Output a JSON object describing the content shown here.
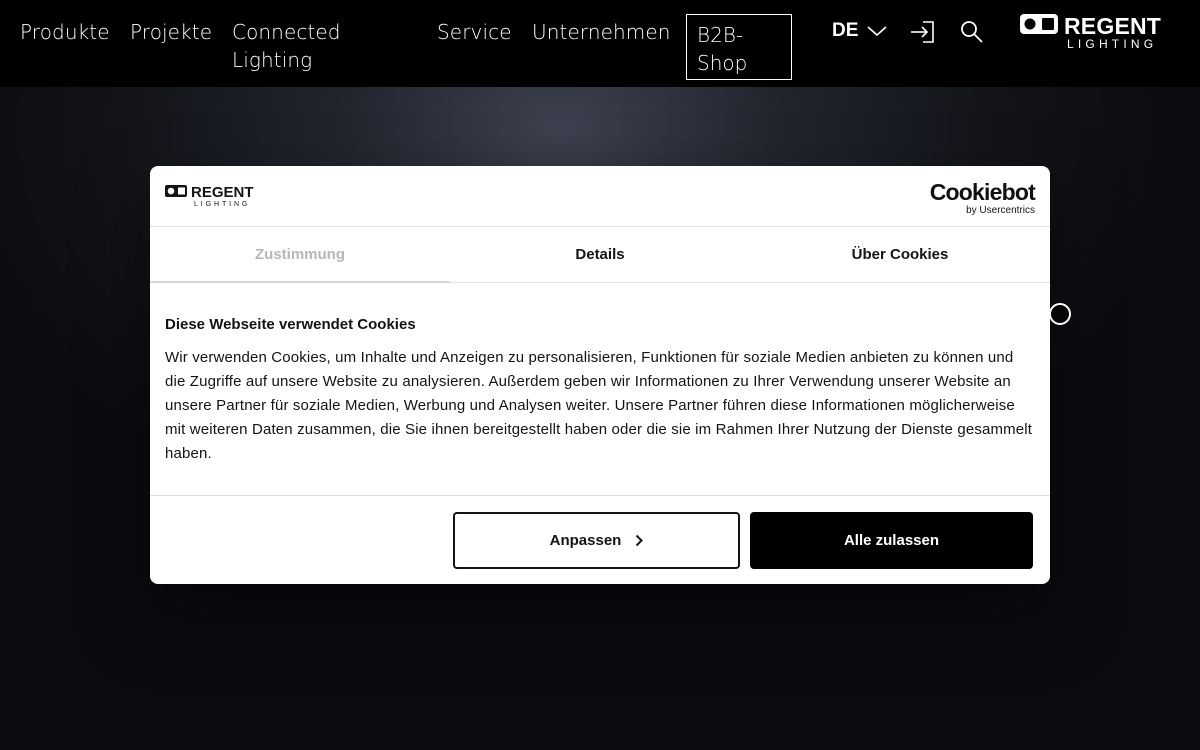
{
  "nav": {
    "items": [
      "Produkte",
      "Projekte",
      "Connected Lighting",
      "Service",
      "Unternehmen"
    ],
    "b2b_label": "B2B-Shop",
    "language": "DE",
    "icons": {
      "login": "login-icon",
      "search": "search-icon",
      "lang_dropdown": "chevron-down-icon"
    },
    "logo": {
      "word": "REGENT",
      "sub": "LIGHTING"
    }
  },
  "dialog": {
    "logo": {
      "word": "REGENT",
      "sub": "LIGHTING"
    },
    "brand": {
      "name": "Cookiebot",
      "sub": "by Usercentrics"
    },
    "tabs": [
      "Zustimmung",
      "Details",
      "Über Cookies"
    ],
    "active_tab": "Zustimmung",
    "title": "Diese Webseite verwendet Cookies",
    "text": "Wir verwenden Cookies, um Inhalte und Anzeigen zu personalisieren, Funktionen für soziale Medien anbieten zu können und die Zugriffe auf unsere Website zu analysieren. Außerdem geben wir Informationen zu Ihrer Verwendung unserer Website an unsere Partner für soziale Medien, Werbung und Analysen weiter. Unsere Partner führen diese Informationen möglicherweise mit weiteren Daten zusammen, die Sie ihnen bereitgestellt haben oder die sie im Rahmen Ihrer Nutzung der Dienste gesammelt haben.",
    "buttons": {
      "customize": "Anpassen",
      "allow_all": "Alle zulassen"
    }
  },
  "colors": {
    "nav_bg": "#000000",
    "accent": "#000000",
    "tab_inactive": "#b7b7b7"
  }
}
